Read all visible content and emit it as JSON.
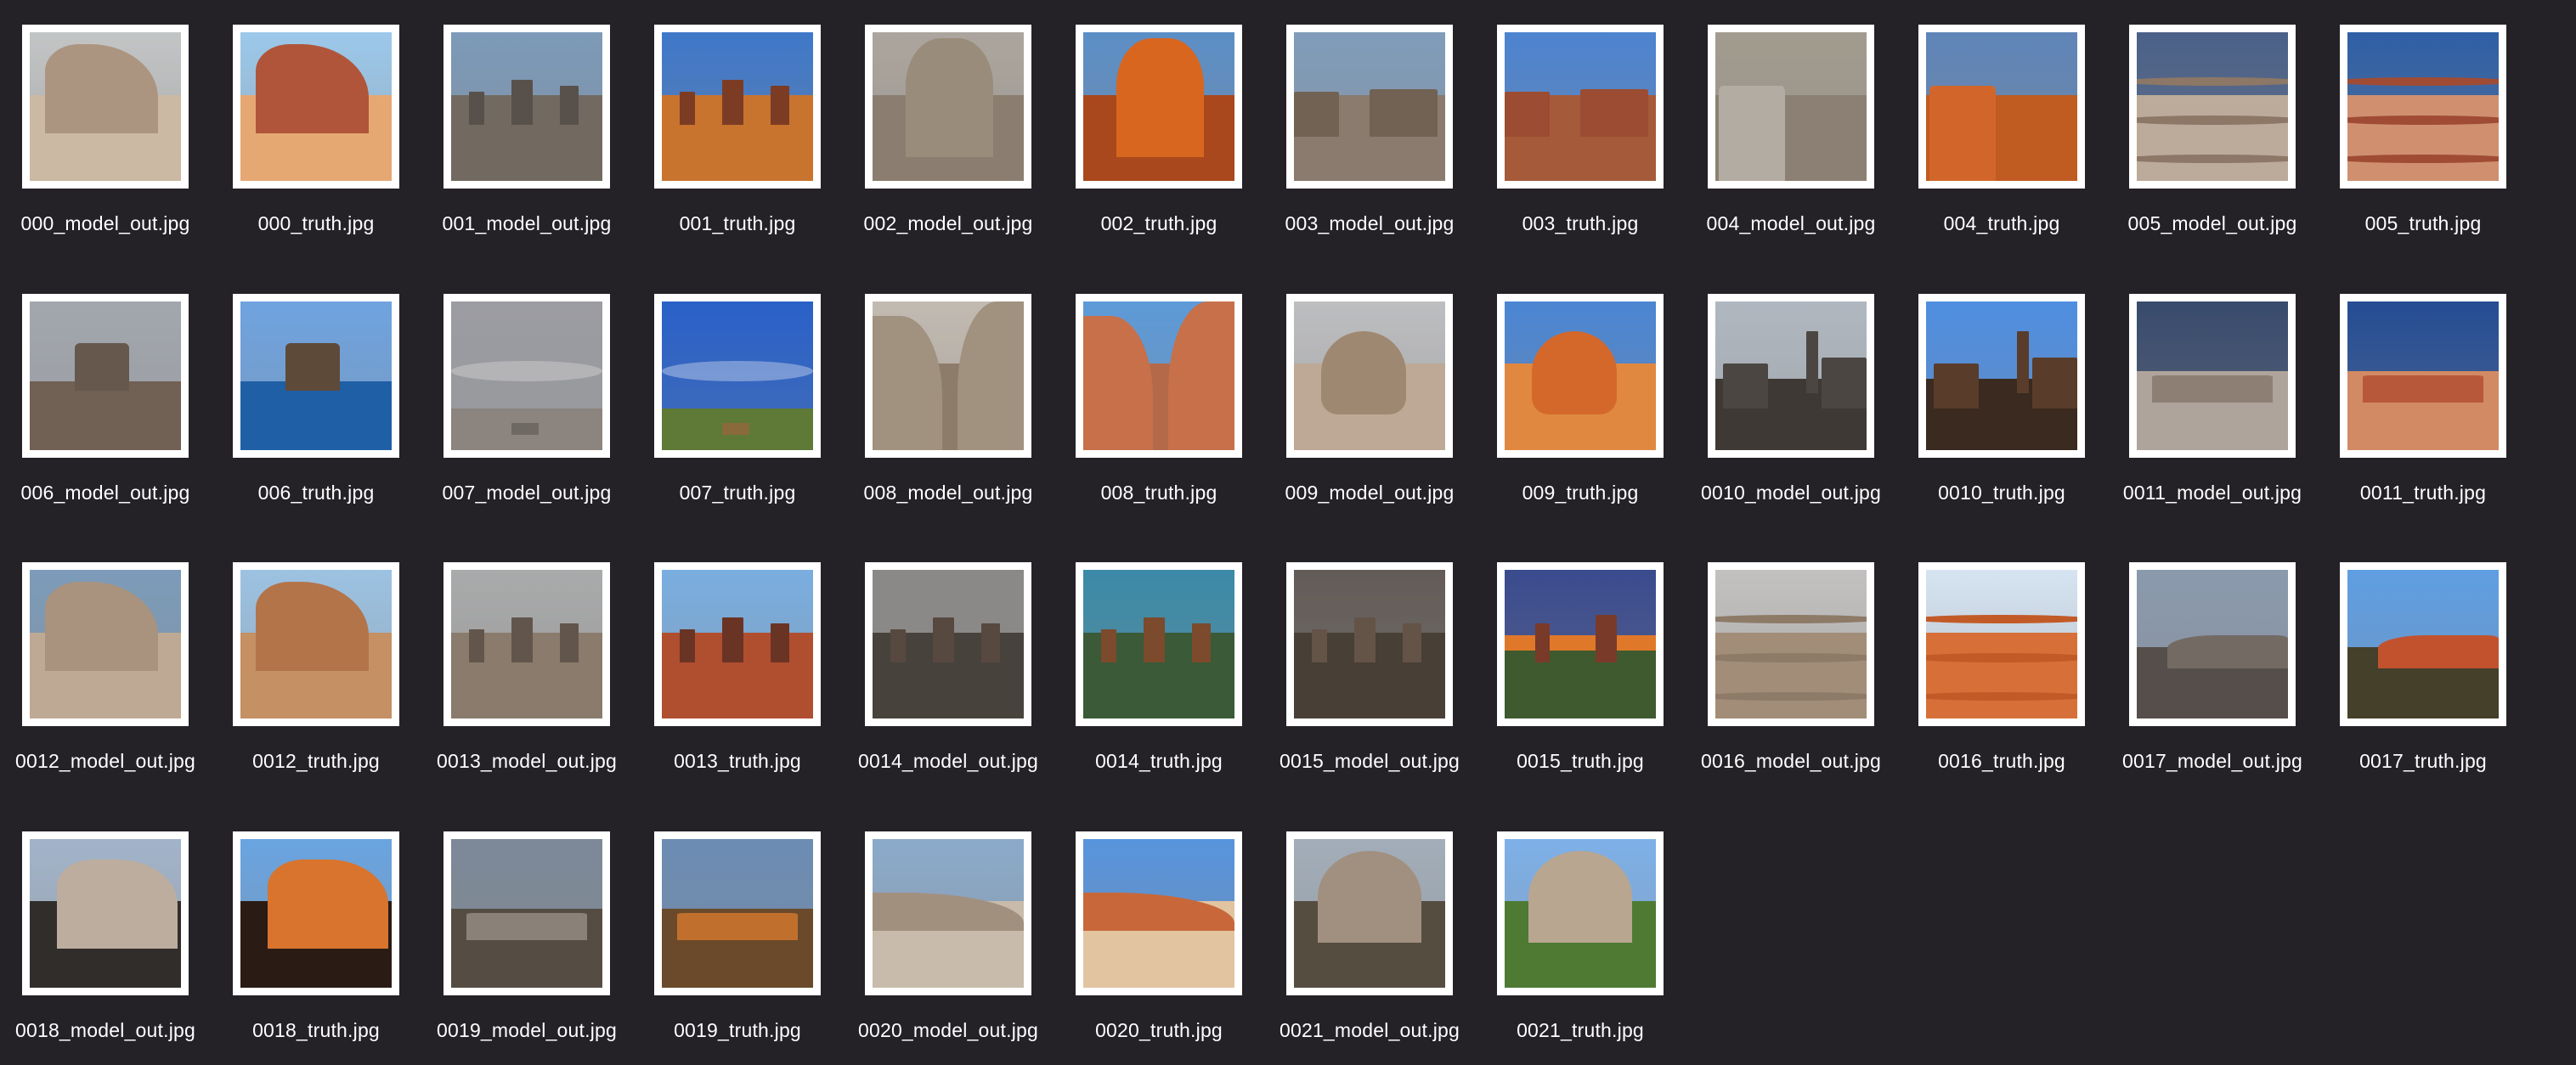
{
  "files": [
    {
      "name": "000_model_out.jpg",
      "sky": "#cfd4d6",
      "ground": "#d9c6ae",
      "rock": "#b49a82",
      "style": "butte-close",
      "muted": true
    },
    {
      "name": "000_truth.jpg",
      "sky": "#9cc8ea",
      "ground": "#e6a873",
      "rock": "#b0553a",
      "style": "butte-close"
    },
    {
      "name": "001_model_out.jpg",
      "sky": "#7aa0c6",
      "ground": "#6d665c",
      "rock": "#4d4640",
      "style": "monuments",
      "muted": true
    },
    {
      "name": "001_truth.jpg",
      "sky": "#3f78c9",
      "ground": "#c8742f",
      "rock": "#7c3c24",
      "style": "monuments"
    },
    {
      "name": "002_model_out.jpg",
      "sky": "#b4aea6",
      "ground": "#8c7e6e",
      "rock": "#9e8f7c",
      "style": "spire",
      "muted": true
    },
    {
      "name": "002_truth.jpg",
      "sky": "#5c8ec6",
      "ground": "#a9481c",
      "rock": "#d8661f",
      "style": "spire"
    },
    {
      "name": "003_model_out.jpg",
      "sky": "#7ea3c8",
      "ground": "#8a7a6c",
      "rock": "#6c5c4c",
      "style": "canyon",
      "muted": true
    },
    {
      "name": "003_truth.jpg",
      "sky": "#4d84d0",
      "ground": "#a55a3a",
      "rock": "#9c4c32",
      "style": "canyon"
    },
    {
      "name": "004_model_out.jpg",
      "sky": "#a8a294",
      "ground": "#8c8172",
      "rock": "#bcb6ac",
      "style": "cliff",
      "muted": true
    },
    {
      "name": "004_truth.jpg",
      "sky": "#5f85b8",
      "ground": "#c05c22",
      "rock": "#d2662a",
      "style": "cliff"
    },
    {
      "name": "005_model_out.jpg",
      "sky": "#3d5b8c",
      "ground": "#c7b5a3",
      "rock": "#8e7662",
      "style": "wave",
      "muted": true
    },
    {
      "name": "005_truth.jpg",
      "sky": "#2f5fa6",
      "ground": "#d09070",
      "rock": "#a04c34",
      "style": "wave"
    },
    {
      "name": "006_model_out.jpg",
      "sky": "#a8b0ba",
      "ground": "#6c5a4c",
      "rock": "#5e5044",
      "style": "lake",
      "muted": true
    },
    {
      "name": "006_truth.jpg",
      "sky": "#6fa3df",
      "ground": "#1f5fa6",
      "rock": "#5e4a38",
      "style": "lake"
    },
    {
      "name": "007_model_out.jpg",
      "sky": "#a0a4ac",
      "ground": "#8b8580",
      "rock": "#6a645e",
      "style": "clouds",
      "muted": true
    },
    {
      "name": "007_truth.jpg",
      "sky": "#2a61c8",
      "ground": "#5e7a36",
      "rock": "#8a6a3a",
      "style": "clouds"
    },
    {
      "name": "008_model_out.jpg",
      "sky": "#cfc8be",
      "ground": "#8f7c68",
      "rock": "#a69580",
      "style": "slot",
      "muted": true
    },
    {
      "name": "008_truth.jpg",
      "sky": "#5d9ad8",
      "ground": "#b46a48",
      "rock": "#c7704a",
      "style": "slot"
    },
    {
      "name": "009_model_out.jpg",
      "sky": "#c8ccd0",
      "ground": "#c9b39b",
      "rock": "#a48a70",
      "style": "hoodoo",
      "muted": true
    },
    {
      "name": "009_truth.jpg",
      "sky": "#4b86d3",
      "ground": "#e08840",
      "rock": "#d4682a",
      "style": "hoodoo"
    },
    {
      "name": "0010_model_out.jpg",
      "sky": "#b8c4d0",
      "ground": "#2e2a26",
      "rock": "#3e3a36",
      "style": "silhouette",
      "muted": true
    },
    {
      "name": "0010_truth.jpg",
      "sky": "#4f8ee0",
      "ground": "#3a2a20",
      "rock": "#5a3c2a",
      "style": "silhouette"
    },
    {
      "name": "0011_model_out.jpg",
      "sky": "#27406b",
      "ground": "#b8ada4",
      "rock": "#8e7f72",
      "style": "mesa",
      "muted": true
    },
    {
      "name": "0011_truth.jpg",
      "sky": "#254d94",
      "ground": "#d28a64",
      "rock": "#b8583a",
      "style": "mesa"
    },
    {
      "name": "0012_model_out.jpg",
      "sky": "#7aa2c8",
      "ground": "#c8b29a",
      "rock": "#b09880",
      "style": "butte-close",
      "muted": true
    },
    {
      "name": "0012_truth.jpg",
      "sky": "#9cc2e2",
      "ground": "#c49064",
      "rock": "#b4744a",
      "style": "butte-close"
    },
    {
      "name": "0013_model_out.jpg",
      "sky": "#b0b4b6",
      "ground": "#8a7a6a",
      "rock": "#5a4c42",
      "style": "monuments",
      "muted": true
    },
    {
      "name": "0013_truth.jpg",
      "sky": "#7aaee0",
      "ground": "#b04e30",
      "rock": "#6a3424",
      "style": "monuments"
    },
    {
      "name": "0014_model_out.jpg",
      "sky": "#8c8c8c",
      "ground": "#3a3530",
      "rock": "#4c3e34",
      "style": "monuments",
      "muted": true
    },
    {
      "name": "0014_truth.jpg",
      "sky": "#3b8aa8",
      "ground": "#3a5a38",
      "rock": "#7c4a2c",
      "style": "monuments"
    },
    {
      "name": "0015_model_out.jpg",
      "sky": "#5a5450",
      "ground": "#3a3128",
      "rock": "#5c4a3c",
      "style": "monuments",
      "muted": true
    },
    {
      "name": "0015_truth.jpg",
      "sky": "#3a4b8e",
      "ground": "#3e5a2e",
      "rock": "#7a3a2a",
      "style": "sunset"
    },
    {
      "name": "0016_model_out.jpg",
      "sky": "#d0d0d0",
      "ground": "#a69078",
      "rock": "#8e7a64",
      "style": "wave",
      "muted": true
    },
    {
      "name": "0016_truth.jpg",
      "sky": "#d6e4f2",
      "ground": "#d67038",
      "rock": "#c25a28",
      "style": "wave"
    },
    {
      "name": "0017_model_out.jpg",
      "sky": "#8aa0b8",
      "ground": "#4a4440",
      "rock": "#6e6660",
      "style": "ridge",
      "muted": true
    },
    {
      "name": "0017_truth.jpg",
      "sky": "#5f9ee2",
      "ground": "#44402a",
      "rock": "#c2522e",
      "style": "ridge"
    },
    {
      "name": "0018_model_out.jpg",
      "sky": "#a8c0dc",
      "ground": "#1e1c1a",
      "rock": "#c8b8a8",
      "style": "cliff-dark",
      "muted": true
    },
    {
      "name": "0018_truth.jpg",
      "sky": "#6aa4e0",
      "ground": "#2a1c14",
      "rock": "#d8742e",
      "style": "cliff-dark"
    },
    {
      "name": "0019_model_out.jpg",
      "sky": "#7a8ca0",
      "ground": "#4a4238",
      "rock": "#8a8278",
      "style": "mesa",
      "muted": true
    },
    {
      "name": "0019_truth.jpg",
      "sky": "#6c8cb4",
      "ground": "#6a4a2a",
      "rock": "#c0702c",
      "style": "mesa"
    },
    {
      "name": "0020_model_out.jpg",
      "sky": "#8cb4dc",
      "ground": "#d6c8b6",
      "rock": "#a89480",
      "style": "dune",
      "muted": true
    },
    {
      "name": "0020_truth.jpg",
      "sky": "#5894dc",
      "ground": "#e2c4a0",
      "rock": "#c8683a",
      "style": "dune"
    },
    {
      "name": "0021_model_out.jpg",
      "sky": "#a8b8c8",
      "ground": "#4a4234",
      "rock": "#a69480",
      "style": "peak",
      "muted": true
    },
    {
      "name": "0021_truth.jpg",
      "sky": "#7eb0e8",
      "ground": "#4e7a34",
      "rock": "#b8a690",
      "style": "peak"
    }
  ]
}
